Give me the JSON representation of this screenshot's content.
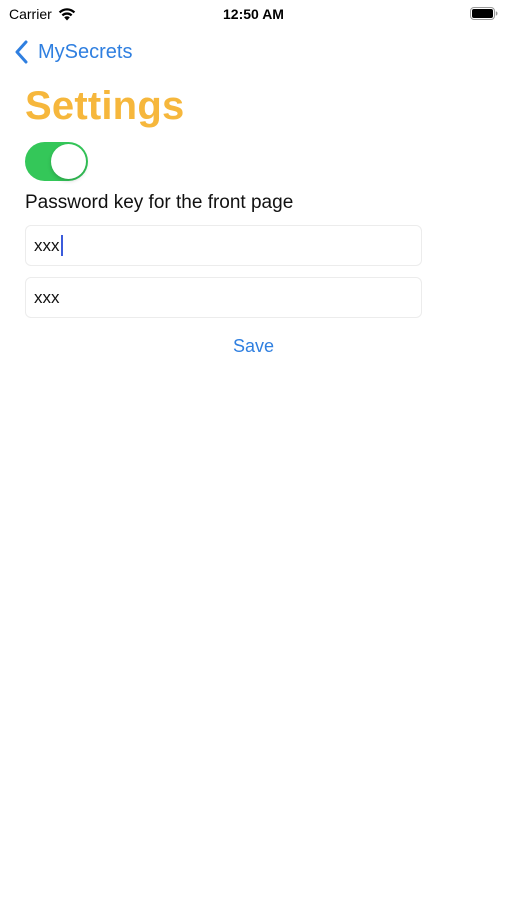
{
  "status_bar": {
    "carrier": "Carrier",
    "time": "12:50 AM",
    "wifi_icon": "wifi-icon",
    "battery_icon": "battery-icon"
  },
  "nav": {
    "back_label": "MySecrets",
    "back_icon": "chevron-left-icon"
  },
  "page": {
    "title": "Settings",
    "toggle_on": true,
    "password_label": "Password key for the front page",
    "field_1_value": "xxx",
    "field_2_value": "xxx",
    "save_label": "Save"
  },
  "colors": {
    "accent": "#2f7fe0",
    "title": "#f6b73c",
    "toggle_on": "#34c759",
    "caret": "#3b5bdb"
  }
}
